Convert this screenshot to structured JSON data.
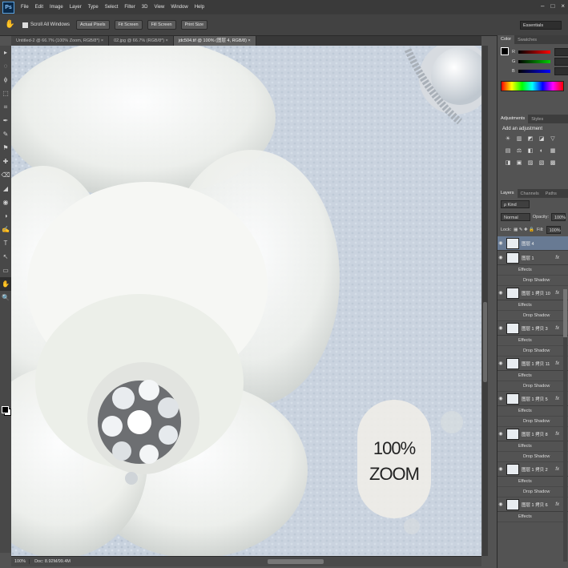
{
  "menubar": {
    "logo": "Ps",
    "items": [
      "File",
      "Edit",
      "Image",
      "Layer",
      "Type",
      "Select",
      "Filter",
      "3D",
      "View",
      "Window",
      "Help"
    ],
    "window_controls": [
      "–",
      "□",
      "×"
    ]
  },
  "options_bar": {
    "scroll_all_label": "Scroll All Windows",
    "buttons": [
      "Actual Pixels",
      "Fit Screen",
      "Fill Screen",
      "Print Size"
    ],
    "workspace": "Essentials"
  },
  "doc_tabs": [
    {
      "label": "Untitled-2 @ 66.7% (100% Zoom, RGB/8*) ×",
      "active": false
    },
    {
      "label": "02.jpg @ 66.7% (RGB/8*) ×",
      "active": false
    },
    {
      "label": "jdc504.tif @ 100% (图层 4, RGB/8) ×",
      "active": true
    }
  ],
  "tools": [
    "▸",
    "◌",
    "ϕ",
    "⬚",
    "⌗",
    "✒",
    "✎",
    "⚑",
    "✚",
    "⌫",
    "◢",
    "◉",
    "◑",
    "✍",
    "T",
    "↖",
    "▭",
    "✋",
    "🔍"
  ],
  "canvas": {
    "zoom_badge_pct": "100%",
    "zoom_badge_word": "ZOOM"
  },
  "status_bar": {
    "zoom": "100%",
    "doc": "Doc: 8.92M/99.4M"
  },
  "color_panel": {
    "tabs": [
      "Color",
      "Swatches"
    ],
    "rows": [
      {
        "label": "R",
        "value": "0",
        "track_color": "#d03030"
      },
      {
        "label": "G",
        "value": "0",
        "track_color": "#30a030"
      },
      {
        "label": "B",
        "value": "0",
        "track_color": "#3050d0"
      }
    ]
  },
  "adjustments_panel": {
    "tabs": [
      "Adjustments",
      "Styles"
    ],
    "title": "Add an adjustment",
    "icons": [
      "☀",
      "▥",
      "◩",
      "◪",
      "▽",
      "▤",
      "⚖",
      "◧",
      "◐",
      "▦",
      "◨",
      "▣",
      "▨",
      "▧",
      "▩"
    ]
  },
  "layers_panel": {
    "tabs": [
      "Layers",
      "Channels",
      "Paths"
    ],
    "kind": "ρ Kind",
    "blend": "Normal",
    "opacity_label": "Opacity:",
    "opacity": "100%",
    "lock_label": "Lock:",
    "fill_label": "Fill:",
    "fill": "100%",
    "layers": [
      {
        "name": "图层 4",
        "selected": true,
        "fx": false
      },
      {
        "name": "图层 1",
        "selected": false,
        "fx": true
      },
      {
        "name": "图层 1 拷贝 10",
        "selected": false,
        "fx": true
      },
      {
        "name": "图层 1 拷贝 3",
        "selected": false,
        "fx": true
      },
      {
        "name": "图层 1 拷贝 11",
        "selected": false,
        "fx": true
      },
      {
        "name": "图层 1 拷贝 5",
        "selected": false,
        "fx": true
      },
      {
        "name": "图层 1 拷贝 8",
        "selected": false,
        "fx": true
      },
      {
        "name": "图层 1 拷贝 2",
        "selected": false,
        "fx": true
      },
      {
        "name": "图层 1 拷贝 6",
        "selected": false,
        "fx": true
      }
    ],
    "effects_label": "Effects",
    "drop_shadow_label": "Drop Shadow"
  }
}
